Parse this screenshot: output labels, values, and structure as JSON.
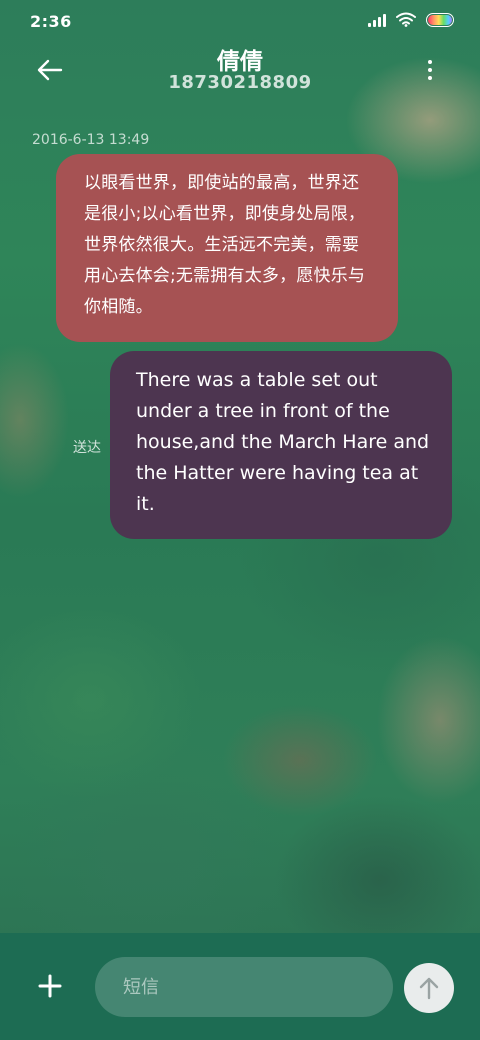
{
  "status_bar": {
    "time": "2:36",
    "icons": [
      "signal-icon",
      "wifi-icon",
      "battery-icon"
    ]
  },
  "header": {
    "back_icon": "arrow-left-icon",
    "contact_name": "倩倩",
    "contact_number": "18730218809",
    "more_icon": "more-vertical-icon"
  },
  "conversation": {
    "timestamp": "2016-6-13 13:49",
    "messages": [
      {
        "direction": "received",
        "text": "以眼看世界，即使站的最高，世界还是很小;以心看世界，即使身处局限，世界依然很大。生活远不完美，需要用心去体会;无需拥有太多，愿快乐与你相随。"
      },
      {
        "direction": "sent",
        "text": "There was a table set out under a tree in front of the house,and the March Hare and the Hatter were having tea at it.",
        "status": "送达"
      }
    ]
  },
  "composer": {
    "add_icon": "plus-icon",
    "placeholder": "短信",
    "value": "",
    "send_icon": "arrow-up-icon"
  },
  "colors": {
    "received_bubble": "#a65253",
    "sent_bubble": "#4d3550",
    "input_bar": "#1d6c53",
    "send_button": "#e9ecec"
  }
}
